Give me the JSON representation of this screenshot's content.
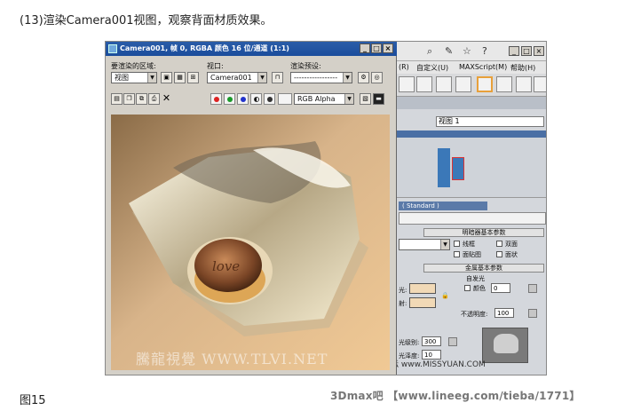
{
  "captions": {
    "top": "(13)渲染Camera001视图，观察背面材质效果。",
    "bottom": "图15",
    "watermark": "3Dmax吧 【www.lineeg.com/tieba/1771】"
  },
  "render_window": {
    "title": "Camera001, 帧 0, RGBA 颜色 16 位/通道 (1:1)",
    "area_label": "要渲染的区域:",
    "area_value": "视图",
    "viewport_label": "视口:",
    "viewport_value": "Camera001",
    "preset_label": "渲染预设:",
    "preset_value": "-----------------",
    "channel_value": "RGB Alpha",
    "watermark": "騰龍視覺 WWW.TLVI.NET",
    "image_text": "love"
  },
  "main_ui": {
    "menu": [
      "(R)",
      "自定义(U)",
      "MAXScript(M)",
      "帮助(H)"
    ],
    "view_select": "视图 1",
    "standard_label": "( Standard )",
    "shader_header": "明暗器基本参数",
    "wire": "线框",
    "two_sided": "双面",
    "face_map": "面贴图",
    "faceted": "面状",
    "metal_header": "金属基本参数",
    "self_illum": "自发光",
    "color_label": "颜色",
    "color_value": "0",
    "light_label": "光:",
    "diffuse_label": "射:",
    "opacity_label": "不透明度:",
    "opacity_value": "100",
    "level_label": "光级别:",
    "level_value": "300",
    "gloss_label": "光泽度:",
    "gloss_value": "10",
    "site_watermark": "思缘设计论坛 www.MISSYUAN.COM"
  },
  "colors": {
    "title_bar": "#1b4d9c",
    "panel": "#d4d0c8",
    "render_bg": "#d9b98c",
    "swatch": "#f1d9b6"
  }
}
